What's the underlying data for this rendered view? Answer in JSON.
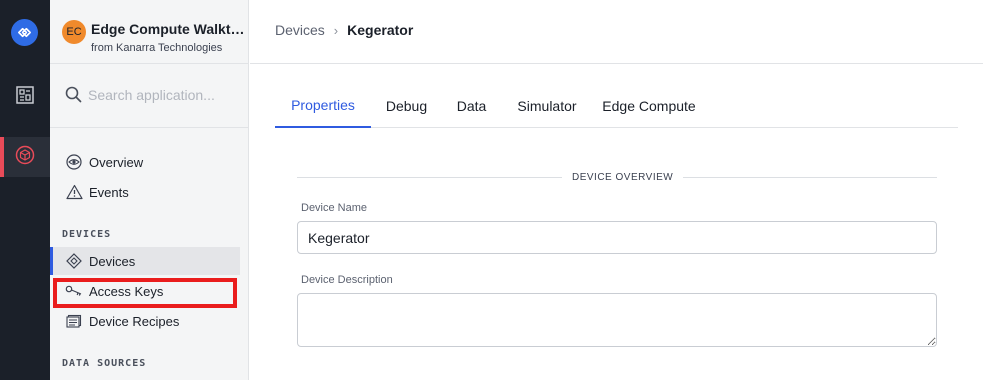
{
  "rail": {
    "logo_icon": "losant-logo-icon",
    "items": [
      {
        "icon": "dashboard-icon",
        "active": false
      },
      {
        "icon": "application-cube-icon",
        "active": true
      }
    ],
    "accent": "#e94b59"
  },
  "app": {
    "avatar_initials": "EC",
    "title": "Edge Compute Walkthrough",
    "subtitle": "from Kanarra Technologies"
  },
  "search": {
    "placeholder": "Search application..."
  },
  "nav": {
    "overview": "Overview",
    "events": "Events",
    "devices_section": "DEVICES",
    "devices": "Devices",
    "access_keys": "Access Keys",
    "device_recipes": "Device Recipes",
    "data_sources_section": "DATA SOURCES"
  },
  "breadcrumb": {
    "parent": "Devices",
    "separator": "›",
    "current": "Kegerator"
  },
  "tabs": [
    "Properties",
    "Debug",
    "Data",
    "Simulator",
    "Edge Compute"
  ],
  "active_tab": "Properties",
  "form": {
    "section_title": "DEVICE OVERVIEW",
    "name_label": "Device Name",
    "name_value": "Kegerator",
    "description_label": "Device Description",
    "description_value": ""
  },
  "colors": {
    "primary": "#2f5be0",
    "highlight": "#ea1d1d",
    "avatar": "#f08a2c"
  }
}
